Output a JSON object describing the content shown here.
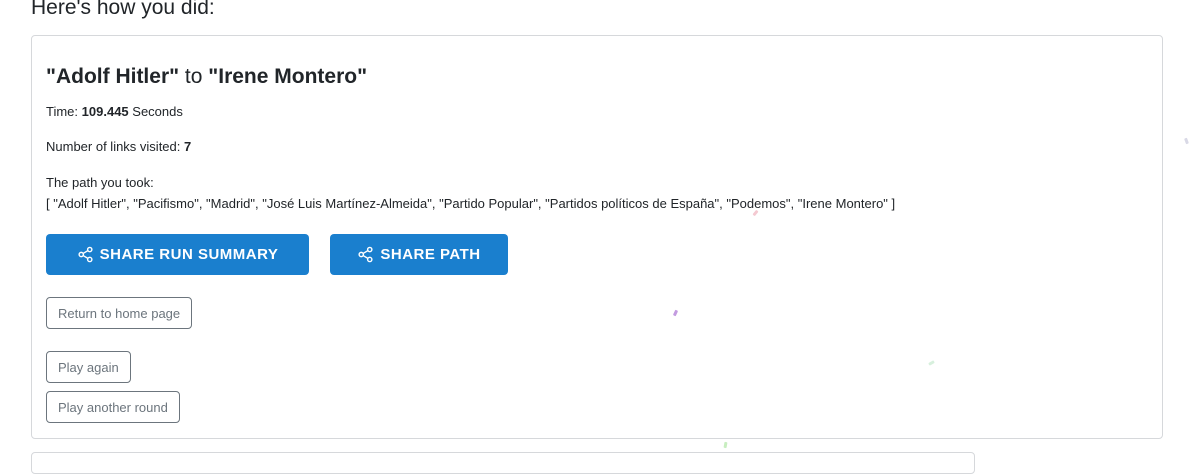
{
  "page": {
    "heading": "Here's how you did:"
  },
  "result": {
    "title_from": "\"Adolf Hitler\"",
    "title_to_word": "to",
    "title_target": "\"Irene Montero\"",
    "time_label": "Time:",
    "time_value": "109.445",
    "time_unit": "Seconds",
    "links_label": "Number of links visited:",
    "links_value": "7",
    "path_label": "The path you took:",
    "path_value": "[ \"Adolf Hitler\", \"Pacifismo\", \"Madrid\", \"José Luis Martínez-Almeida\", \"Partido Popular\", \"Partidos políticos de España\", \"Podemos\", \"Irene Montero\" ]"
  },
  "actions": {
    "share_summary_label": "SHARE RUN SUMMARY",
    "share_path_label": "SHARE PATH",
    "return_home_label": "Return to home page",
    "play_again_label": "Play again",
    "play_another_label": "Play another round"
  },
  "colors": {
    "primary": "#1a7fce",
    "outline": "#6c757d",
    "card_border": "#d6d8db"
  },
  "icons": {
    "share": "share-icon"
  }
}
